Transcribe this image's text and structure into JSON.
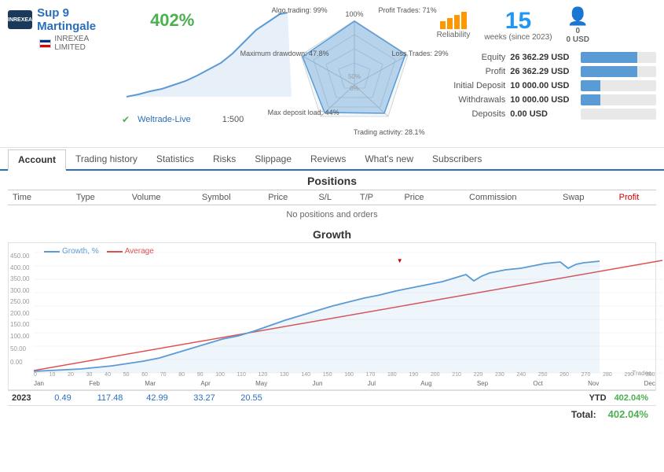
{
  "header": {
    "logo_text": "INREXEA",
    "brand_name": "Sup 9 Martingale",
    "sub_brand": "INREXEA LIMITED",
    "growth_pct": "402%",
    "broker": "Weltrade-Live",
    "leverage": "1:500"
  },
  "radar": {
    "algo_trading": "Algo trading: 99%",
    "max_drawdown": "Maximum drawdown: 47.8%",
    "max_deposit_load": "Max deposit load: 44%",
    "trading_activity": "Trading activity: 28.1%",
    "profit_trades": "Profit Trades: 71%",
    "loss_trades": "Loss Trades: 29%"
  },
  "top_stats": {
    "reliability_label": "Reliability",
    "weeks_num": "15",
    "weeks_label": "weeks (since 2023)",
    "subscribers_num": "0",
    "subscribers_usd": "0 USD"
  },
  "metrics": [
    {
      "label": "Equity",
      "value": "26 362.29 USD",
      "bar_pct": 75
    },
    {
      "label": "Profit",
      "value": "26 362.29 USD",
      "bar_pct": 75
    },
    {
      "label": "Initial Deposit",
      "value": "10 000.00 USD",
      "bar_pct": 25
    },
    {
      "label": "Withdrawals",
      "value": "10 000.00 USD",
      "bar_pct": 25
    },
    {
      "label": "Deposits",
      "value": "0.00 USD",
      "bar_pct": 0
    }
  ],
  "tabs": [
    "Account",
    "Trading history",
    "Statistics",
    "Risks",
    "Slippage",
    "Reviews",
    "What's new",
    "Subscribers"
  ],
  "active_tab": "Account",
  "positions": {
    "title": "Positions",
    "columns": [
      "Time",
      "Type",
      "Volume",
      "Symbol",
      "Price",
      "S/L",
      "T/P",
      "Price",
      "Commission",
      "Swap",
      "Profit"
    ],
    "empty_message": "No positions and orders"
  },
  "growth": {
    "title": "Growth",
    "legend": [
      "Growth, %",
      "Average"
    ],
    "y_labels": [
      "450.00",
      "400.00",
      "350.00",
      "300.00",
      "250.00",
      "200.00",
      "150.00",
      "100.00",
      "50.00",
      "0.00"
    ],
    "x_labels": [
      "0",
      "10",
      "20",
      "30",
      "40",
      "50",
      "60",
      "70",
      "80",
      "90",
      "100",
      "110",
      "120",
      "130",
      "140",
      "150",
      "160",
      "170",
      "180",
      "190",
      "200",
      "210",
      "220",
      "230",
      "240",
      "250",
      "260",
      "270",
      "280",
      "290",
      "300"
    ],
    "month_labels": [
      "Jan",
      "Feb",
      "Mar",
      "Apr",
      "May",
      "Jun",
      "Jul",
      "Aug",
      "Sep",
      "Oct",
      "Nov",
      "Dec"
    ],
    "trades_label": "Trades",
    "ytd_year": "2023",
    "ytd_values": [
      "0.49",
      "117.48",
      "42.99",
      "33.27",
      "20.55"
    ],
    "ytd_label": "YTD",
    "ytd_pct": "402.04%",
    "total_label": "Total:",
    "total_pct": "402.04%"
  }
}
